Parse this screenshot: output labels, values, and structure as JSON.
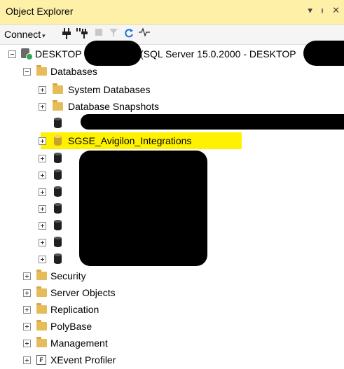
{
  "panel": {
    "title": "Object Explorer",
    "controls": [
      "▾",
      "ᵻ",
      "✕"
    ]
  },
  "toolbar": {
    "connect_label": "Connect",
    "connect_caret": "▾",
    "icons": [
      "connect-plug-icon",
      "disconnect-plug-icon",
      "stop-icon",
      "filter-icon",
      "refresh-icon",
      "activity-monitor-icon"
    ]
  },
  "tree": {
    "server_label_prefix": "DESKTOP",
    "server_label_suffix": "(SQL Server 15.0.2000 - DESKTOP",
    "databases_label": "Databases",
    "system_databases_label": "System Databases",
    "database_snapshots_label": "Database Snapshots",
    "highlighted_db_label": "SGSE_Avigilon_Integrations",
    "security_label": "Security",
    "server_objects_label": "Server Objects",
    "replication_label": "Replication",
    "polybase_label": "PolyBase",
    "management_label": "Management",
    "xevent_label": "XEvent Profiler"
  },
  "colors": {
    "title_bar": "#fff0a8",
    "highlight": "#fff200",
    "folder": "#e6bc5b",
    "server_status": "#2fa84f"
  }
}
